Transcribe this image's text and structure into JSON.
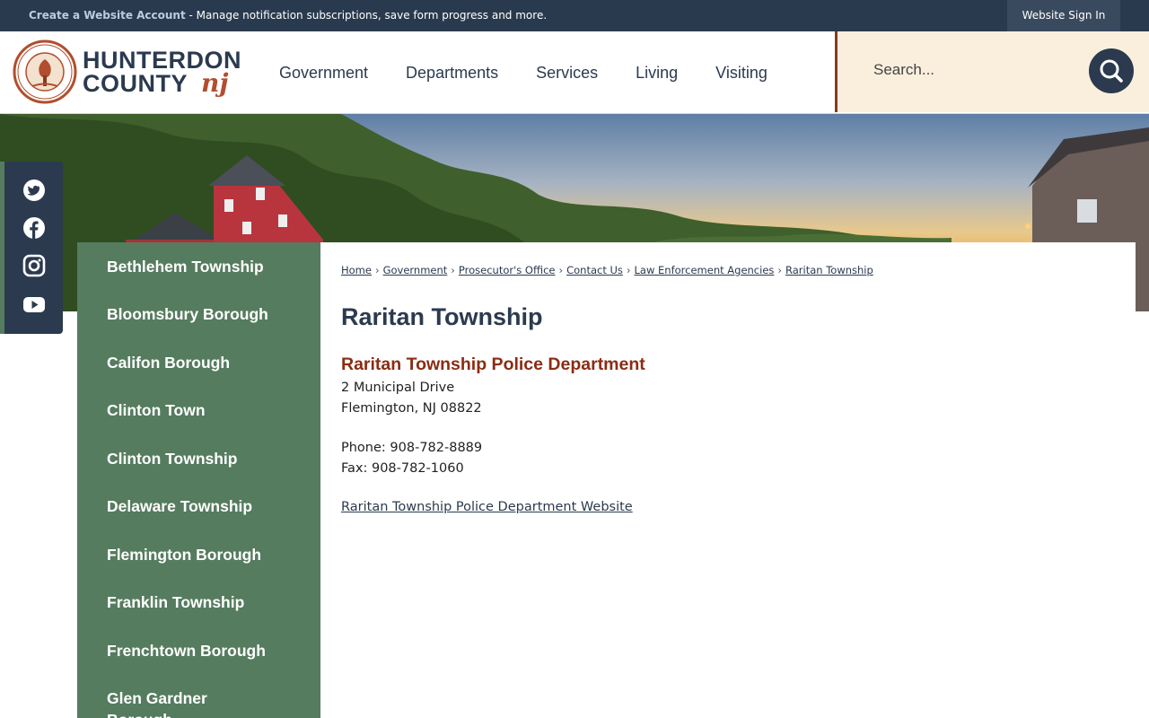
{
  "topbar": {
    "create_account_link": "Create a Website Account",
    "create_account_desc": " - Manage notification subscriptions, save form progress and more.",
    "sign_in": "Website Sign In"
  },
  "logo": {
    "line1": "HUNTERDON",
    "line2": "COUNTY",
    "script": "nj",
    "seal_top": "HUNTERDON COUNTY",
    "seal_bottom": "NEW JERSEY"
  },
  "nav": {
    "items": [
      "Government",
      "Departments",
      "Services",
      "Living",
      "Visiting"
    ]
  },
  "search": {
    "placeholder": "Search..."
  },
  "social": {
    "icons": [
      "twitter-icon",
      "facebook-icon",
      "instagram-icon",
      "youtube-icon"
    ]
  },
  "sidenav": {
    "items": [
      "Bethlehem Township",
      "Bloomsbury Borough",
      "Califon Borough",
      "Clinton Town",
      "Clinton Township",
      "Delaware Township",
      "Flemington Borough",
      "Franklin Township",
      "Frenchtown Borough",
      "Glen Gardner Borough"
    ]
  },
  "breadcrumb": [
    "Home",
    "Government",
    "Prosecutor's Office",
    "Contact Us",
    "Law Enforcement Agencies",
    "Raritan Township"
  ],
  "page": {
    "title": "Raritan Township",
    "department": "Raritan Township Police Department",
    "address1": "2 Municipal Drive",
    "address2": "Flemington, NJ 08822",
    "phone": "Phone: 908-782-8889",
    "fax": "Fax: 908-782-1060",
    "website_link": "Raritan Township Police Department Website"
  },
  "colors": {
    "navy": "#2b3a4f",
    "green": "#557c5f",
    "rust": "#8b2c13",
    "cream": "#faefdd"
  }
}
